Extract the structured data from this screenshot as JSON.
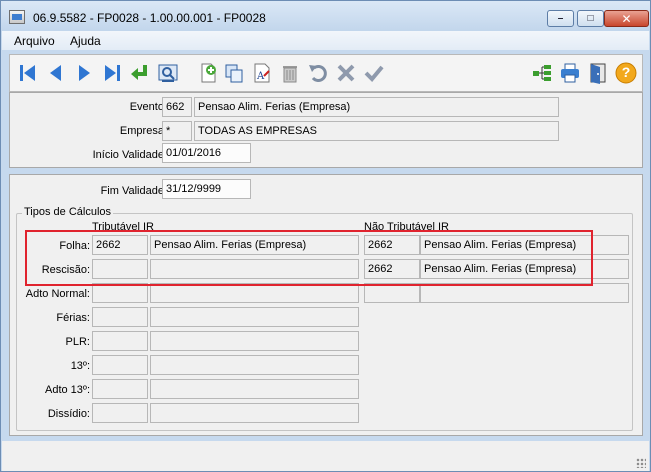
{
  "window": {
    "title": "06.9.5582 - FP0028 - 1.00.00.001 - FP0028",
    "minimize": "–",
    "maximize": "□",
    "close": "✕"
  },
  "menu": [
    "Arquivo",
    "Ajuda"
  ],
  "toolbar": {
    "left_icons": [
      "first-record-icon",
      "previous-record-icon",
      "next-record-icon",
      "last-record-icon",
      "goto-record-icon",
      "search-record-icon",
      "add-record-icon",
      "copy-record-icon",
      "edit-record-icon",
      "delete-record-icon",
      "undo-icon",
      "cancel-icon",
      "save-icon"
    ],
    "right_icons": [
      "structure-icon",
      "print-icon",
      "exit-door-icon",
      "help-icon"
    ],
    "help_glyph": "?"
  },
  "header": {
    "evento_label": "Evento:",
    "evento_code": "662",
    "evento_desc": "Pensao Alim. Ferias (Empresa)",
    "empresa_label": "Empresa:",
    "empresa_code": "*",
    "empresa_desc": "TODAS AS EMPRESAS",
    "inicio_label": "Início Validade:",
    "inicio_value": "01/01/2016"
  },
  "detail": {
    "fim_label": "Fim Validade:",
    "fim_value": "31/12/9999",
    "group_title": "Tipos de Cálculos",
    "col_tributavel": "Tributável IR",
    "col_nao_tributavel": "Não Tributável IR",
    "rows": [
      {
        "label": "Folha:",
        "trib_code": "2662",
        "trib_desc": "Pensao Alim. Ferias (Empresa)",
        "nao_code": "2662",
        "nao_desc": "Pensao Alim. Ferias (Empresa)"
      },
      {
        "label": "Rescisão:",
        "trib_code": "",
        "trib_desc": "",
        "nao_code": "2662",
        "nao_desc": "Pensao Alim. Ferias (Empresa)"
      },
      {
        "label": "Adto Normal:",
        "trib_code": "",
        "trib_desc": "",
        "nao_code": "",
        "nao_desc": ""
      },
      {
        "label": "Férias:",
        "trib_code": "",
        "trib_desc": ""
      },
      {
        "label": "PLR:",
        "trib_code": "",
        "trib_desc": ""
      },
      {
        "label": "13º:",
        "trib_code": "",
        "trib_desc": ""
      },
      {
        "label": "Adto 13º:",
        "trib_code": "",
        "trib_desc": ""
      },
      {
        "label": "Dissídio:",
        "trib_code": "",
        "trib_desc": ""
      }
    ]
  }
}
